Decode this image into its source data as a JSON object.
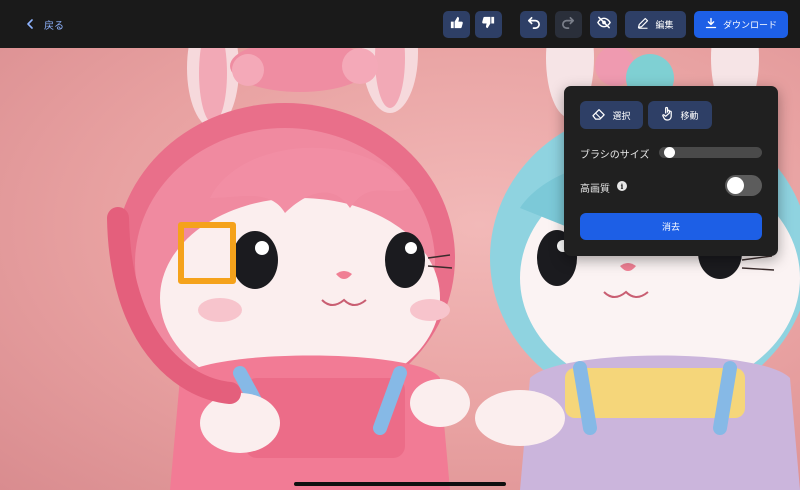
{
  "toolbar": {
    "back_label": "戻る",
    "edit_label": "編集",
    "download_label": "ダウンロード",
    "icons": [
      "thumbs-up-icon",
      "thumbs-down-icon",
      "undo-icon",
      "redo-icon",
      "eye-off-icon",
      "pencil-icon",
      "download-icon"
    ]
  },
  "panel": {
    "erase_mode_label": "選択",
    "move_mode_label": "移動",
    "brush_size_label": "ブラシのサイズ",
    "brush_size_value": 0.05,
    "hq_label": "高画質",
    "hq_enabled": false,
    "erase_button_label": "消去"
  },
  "colors": {
    "accent": "#1d5fe6",
    "secondary_button": "#2e3f66",
    "brush_cursor": "#f5a21b",
    "panel_bg": "#202020"
  }
}
